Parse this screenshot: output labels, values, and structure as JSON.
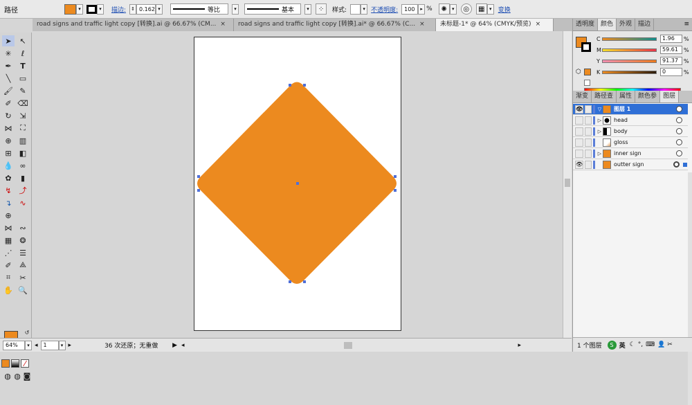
{
  "control_bar": {
    "object_type": "路径",
    "fill_color": "#ec8a1f",
    "stroke_label": "描边:",
    "stroke_weight": "0.162",
    "profile_label": "等比",
    "brush_label": "基本",
    "style_label": "样式:",
    "opacity_label": "不透明度:",
    "opacity_value": "100",
    "opacity_unit": "%",
    "transform_label": "变换"
  },
  "tabs": [
    {
      "label": "road signs and traffic light copy [转换].ai @ 66.67% (CM...",
      "close": "×"
    },
    {
      "label": "road signs and traffic light copy [转换].ai* @ 66.67% (C...",
      "close": "×"
    },
    {
      "label": "未标题-1* @ 64% (CMYK/预览)",
      "close": "×"
    }
  ],
  "tools": {
    "fill_color": "#ec8a1f",
    "stroke_color": "#000000"
  },
  "canvas": {
    "shape_fill": "#ec8a1f",
    "selection_color": "#4f6fd8"
  },
  "status_bar": {
    "zoom": "64%",
    "page": "1",
    "history": "36 次还原；无重做"
  },
  "color_panel": {
    "tabs": [
      "透明度",
      "颜色",
      "外观",
      "描边"
    ],
    "active_tab": "颜色",
    "channels": [
      {
        "label": "C",
        "value": "1.96",
        "unit": "%"
      },
      {
        "label": "M",
        "value": "59.61",
        "unit": "%"
      },
      {
        "label": "Y",
        "value": "91.37",
        "unit": "%"
      },
      {
        "label": "K",
        "value": "0",
        "unit": "%"
      }
    ]
  },
  "layers_panel": {
    "tabs": [
      "渐变",
      "路径查",
      "属性",
      "颜色参",
      "图层"
    ],
    "active_tab": "图层",
    "layers": [
      {
        "name": "图层 1",
        "selected": true,
        "visible": true
      },
      {
        "name": "head",
        "visible": false
      },
      {
        "name": "body",
        "visible": false
      },
      {
        "name": "gloss",
        "visible": false
      },
      {
        "name": "inner sign",
        "visible": false
      },
      {
        "name": "outter sign",
        "visible": true
      }
    ],
    "footer": "1 个图层",
    "ime_label": "英"
  }
}
